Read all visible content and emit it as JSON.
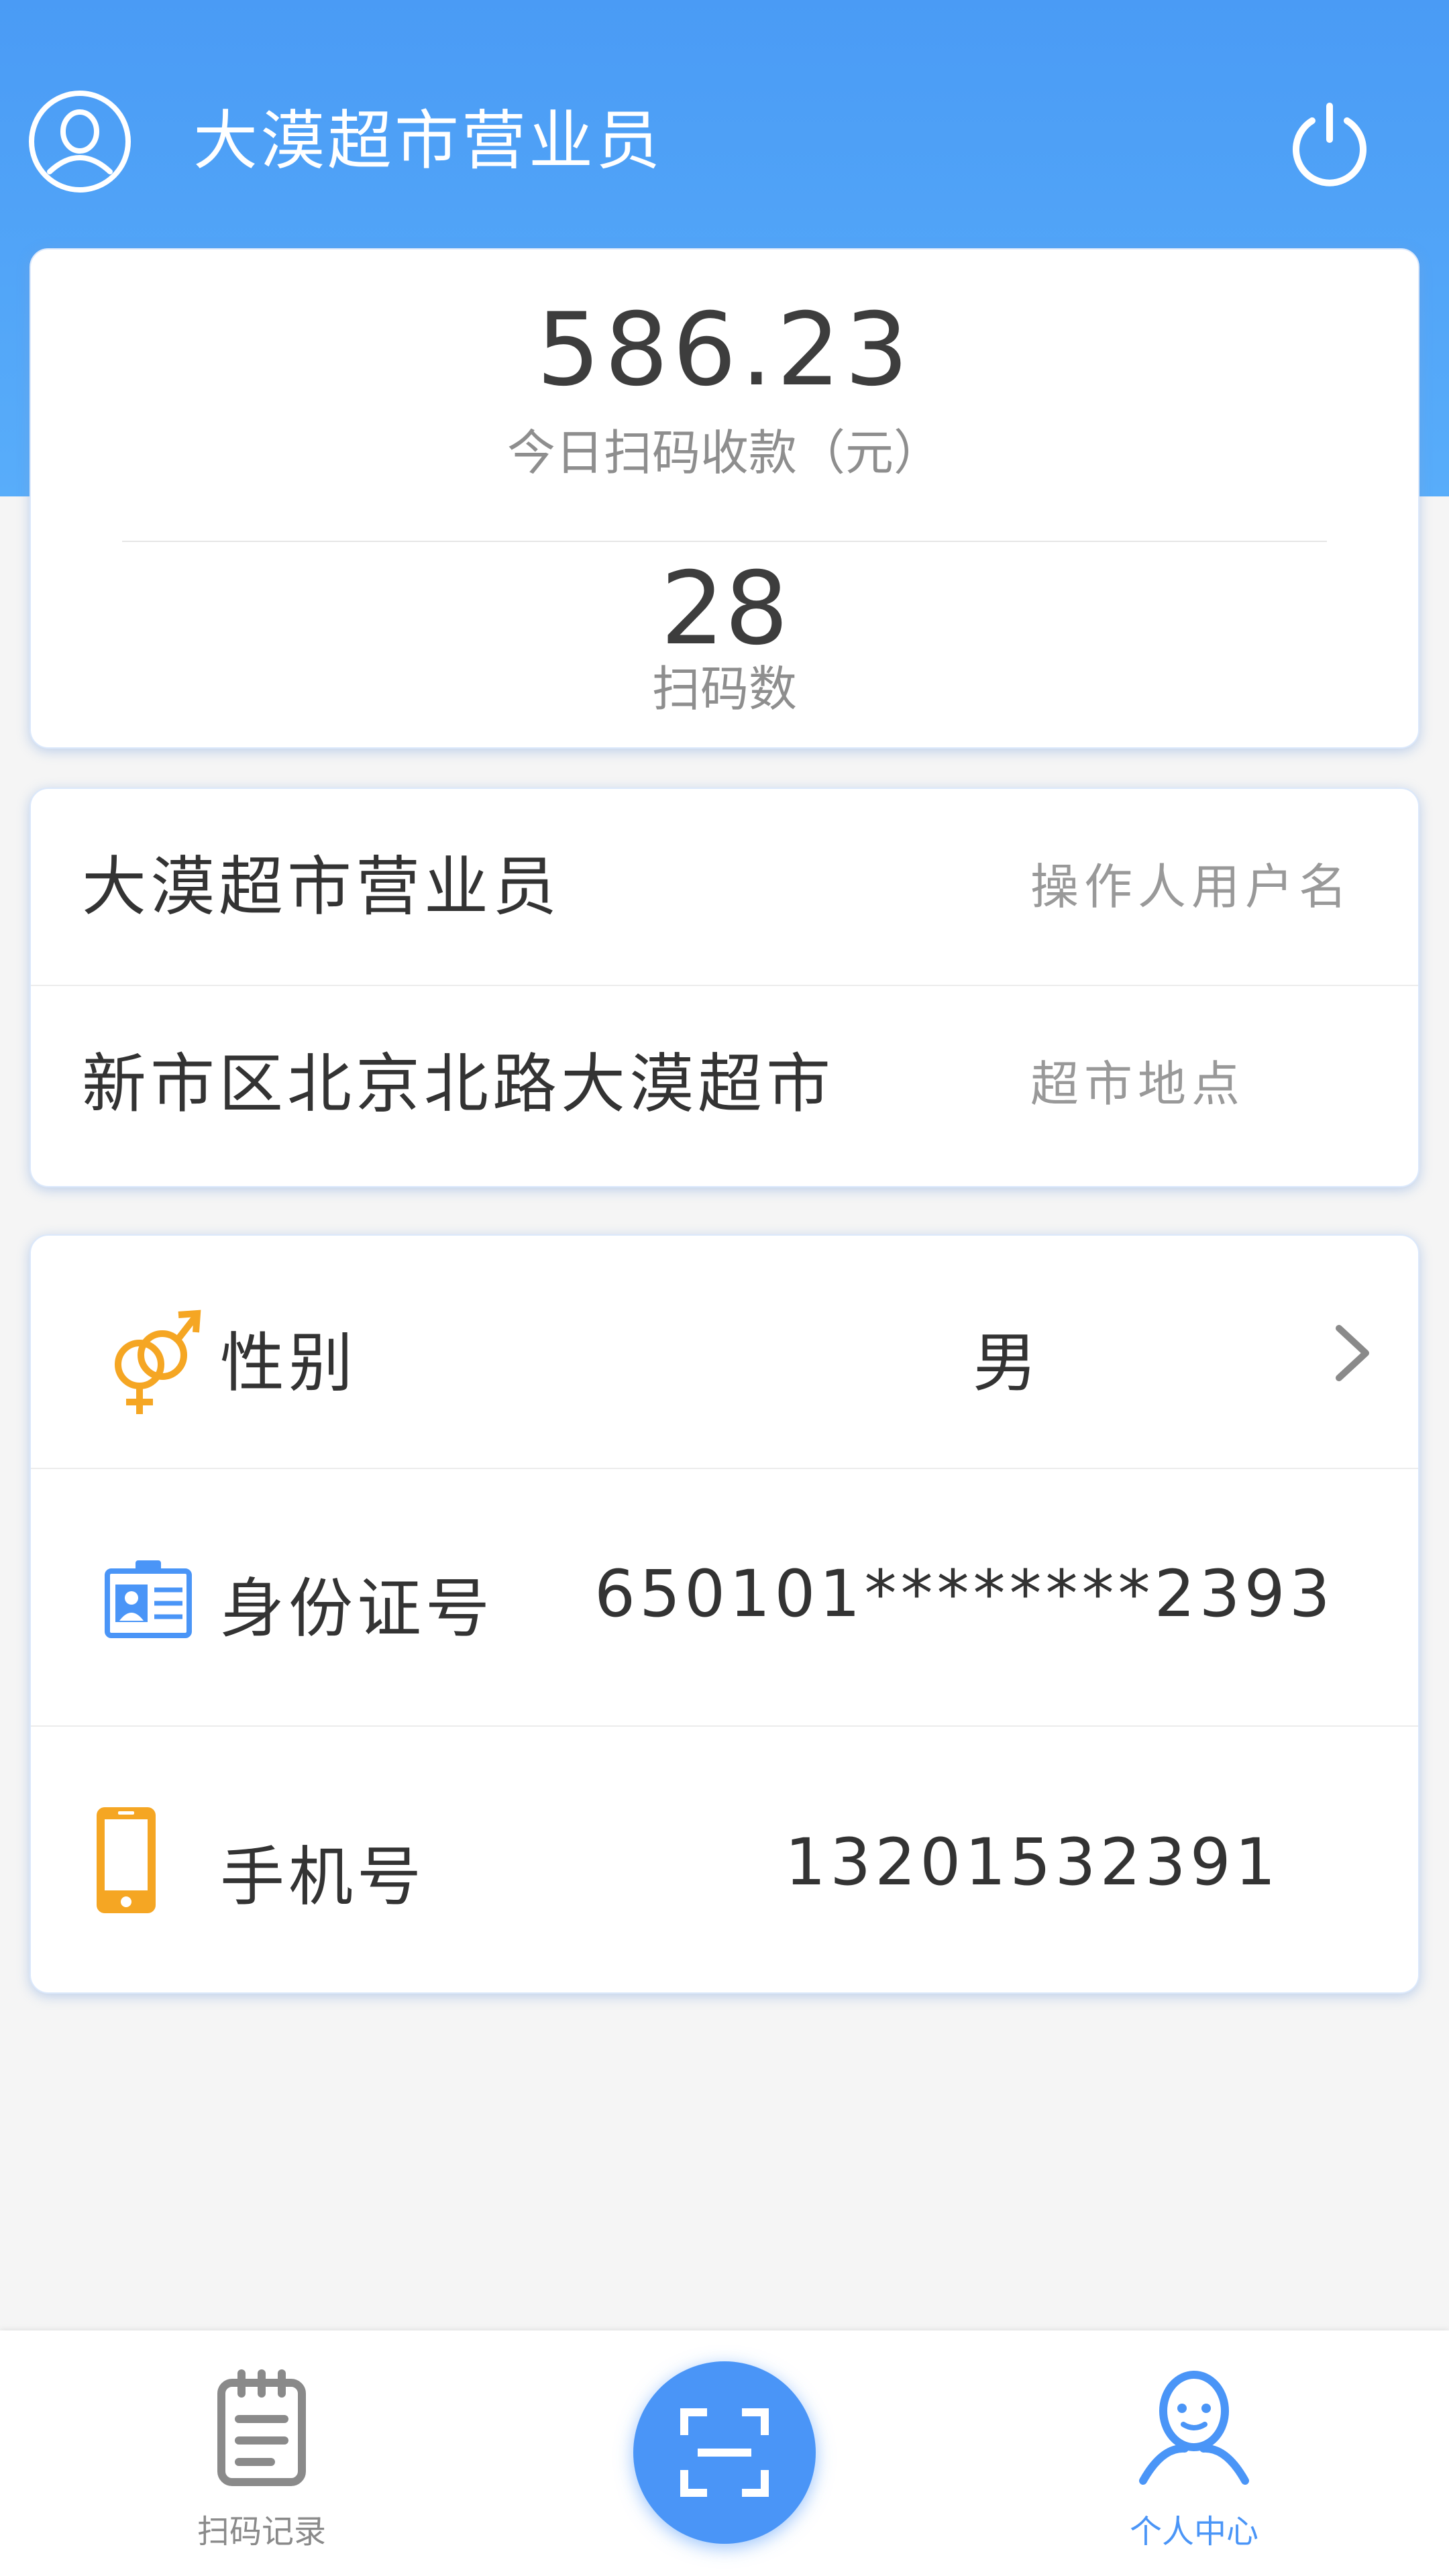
{
  "header": {
    "title": "大漠超市营业员",
    "avatar_icon": "user-avatar-icon",
    "power_icon": "power-icon"
  },
  "stats": {
    "amount": "586.23",
    "amount_label": "今日扫码收款（元）",
    "count": "28",
    "count_label": "扫码数"
  },
  "info": [
    {
      "value": "大漠超市营业员",
      "label": "操作人用户名"
    },
    {
      "value": "新市区北京北路大漠超市",
      "label": "超市地点"
    }
  ],
  "details": {
    "gender": {
      "icon": "gender-icon",
      "label": "性别",
      "value": "男"
    },
    "id_card": {
      "icon": "id-card-icon",
      "label": "身份证号",
      "value": "650101********2393"
    },
    "phone": {
      "icon": "mobile-phone-icon",
      "label": "手机号",
      "value": "13201532391"
    }
  },
  "tabbar": {
    "left": {
      "icon": "notepad-icon",
      "label": "扫码记录"
    },
    "center": {
      "icon": "scan-icon"
    },
    "right": {
      "icon": "person-icon",
      "label": "个人中心"
    }
  },
  "colors": {
    "header": "#4a9bf5",
    "accent": "#4a95f7",
    "icon_orange": "#f5a623",
    "icon_blue": "#4a95f7"
  }
}
